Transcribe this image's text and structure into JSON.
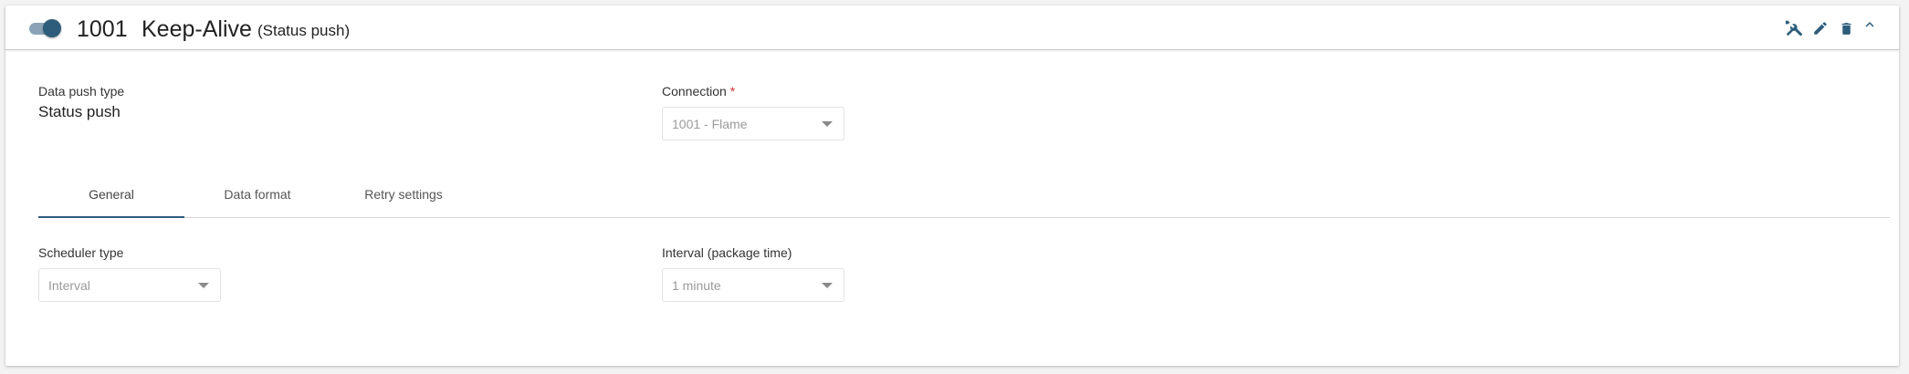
{
  "header": {
    "enabled": true,
    "id": "1001",
    "name": "Keep-Alive",
    "type": "(Status push)",
    "icons": [
      "tools-icon",
      "edit-icon",
      "delete-icon",
      "collapse-chevron-icon"
    ]
  },
  "data_push_type": {
    "label": "Data push type",
    "value": "Status push"
  },
  "connection": {
    "label": "Connection",
    "required_mark": "*",
    "value": "1001 - Flame"
  },
  "tabs": [
    {
      "label": "General",
      "active": true
    },
    {
      "label": "Data format",
      "active": false
    },
    {
      "label": "Retry settings",
      "active": false
    }
  ],
  "scheduler_type": {
    "label": "Scheduler type",
    "value": "Interval"
  },
  "interval": {
    "label": "Interval (package time)",
    "value": "1 minute"
  },
  "colors": {
    "accent": "#2d5d7b",
    "toggle_track": "#8aa4b5",
    "required": "#d32f2f"
  }
}
